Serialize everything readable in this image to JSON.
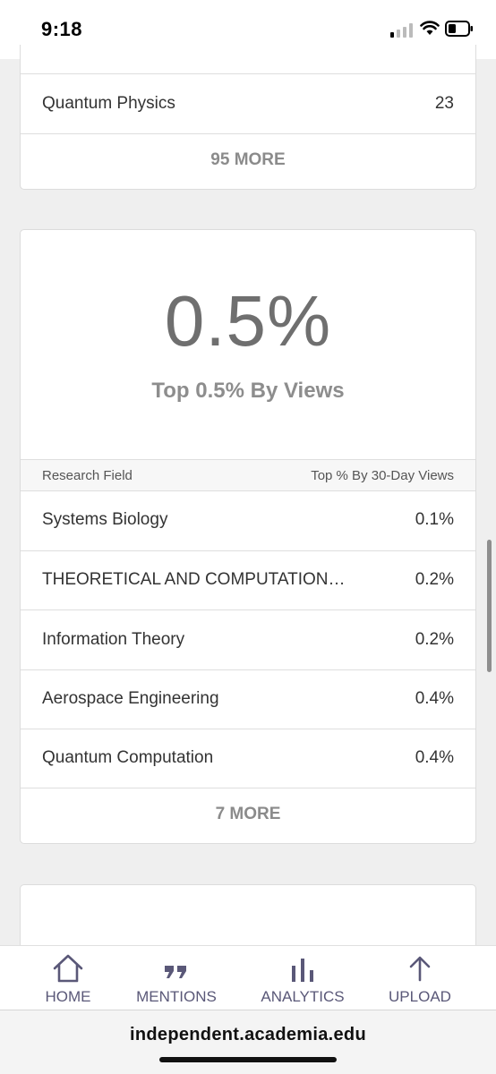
{
  "status_bar": {
    "time": "9:18"
  },
  "top_card": {
    "rows": [
      {
        "name": "Quantum Physics",
        "value": "23"
      }
    ],
    "more_label": "95 MORE"
  },
  "rank_card": {
    "big_percent": "0.5%",
    "subtitle": "Top 0.5% By Views",
    "header": {
      "col1": "Research Field",
      "col2": "Top % By 30-Day Views"
    },
    "rows": [
      {
        "name": "Systems Biology",
        "value": "0.1%"
      },
      {
        "name": "THEORETICAL AND COMPUTATION…",
        "value": "0.2%"
      },
      {
        "name": "Information Theory",
        "value": "0.2%"
      },
      {
        "name": "Aerospace Engineering",
        "value": "0.4%"
      },
      {
        "name": "Quantum Computation",
        "value": "0.4%"
      }
    ],
    "more_label": "7 MORE"
  },
  "tab_bar": {
    "accent_color": "#5a5878",
    "tabs": [
      {
        "label": "HOME",
        "icon": "home-icon"
      },
      {
        "label": "MENTIONS",
        "icon": "quote-icon"
      },
      {
        "label": "ANALYTICS",
        "icon": "bar-chart-icon"
      },
      {
        "label": "UPLOAD",
        "icon": "arrow-up-icon"
      }
    ]
  },
  "browser": {
    "url": "independent.academia.edu"
  }
}
